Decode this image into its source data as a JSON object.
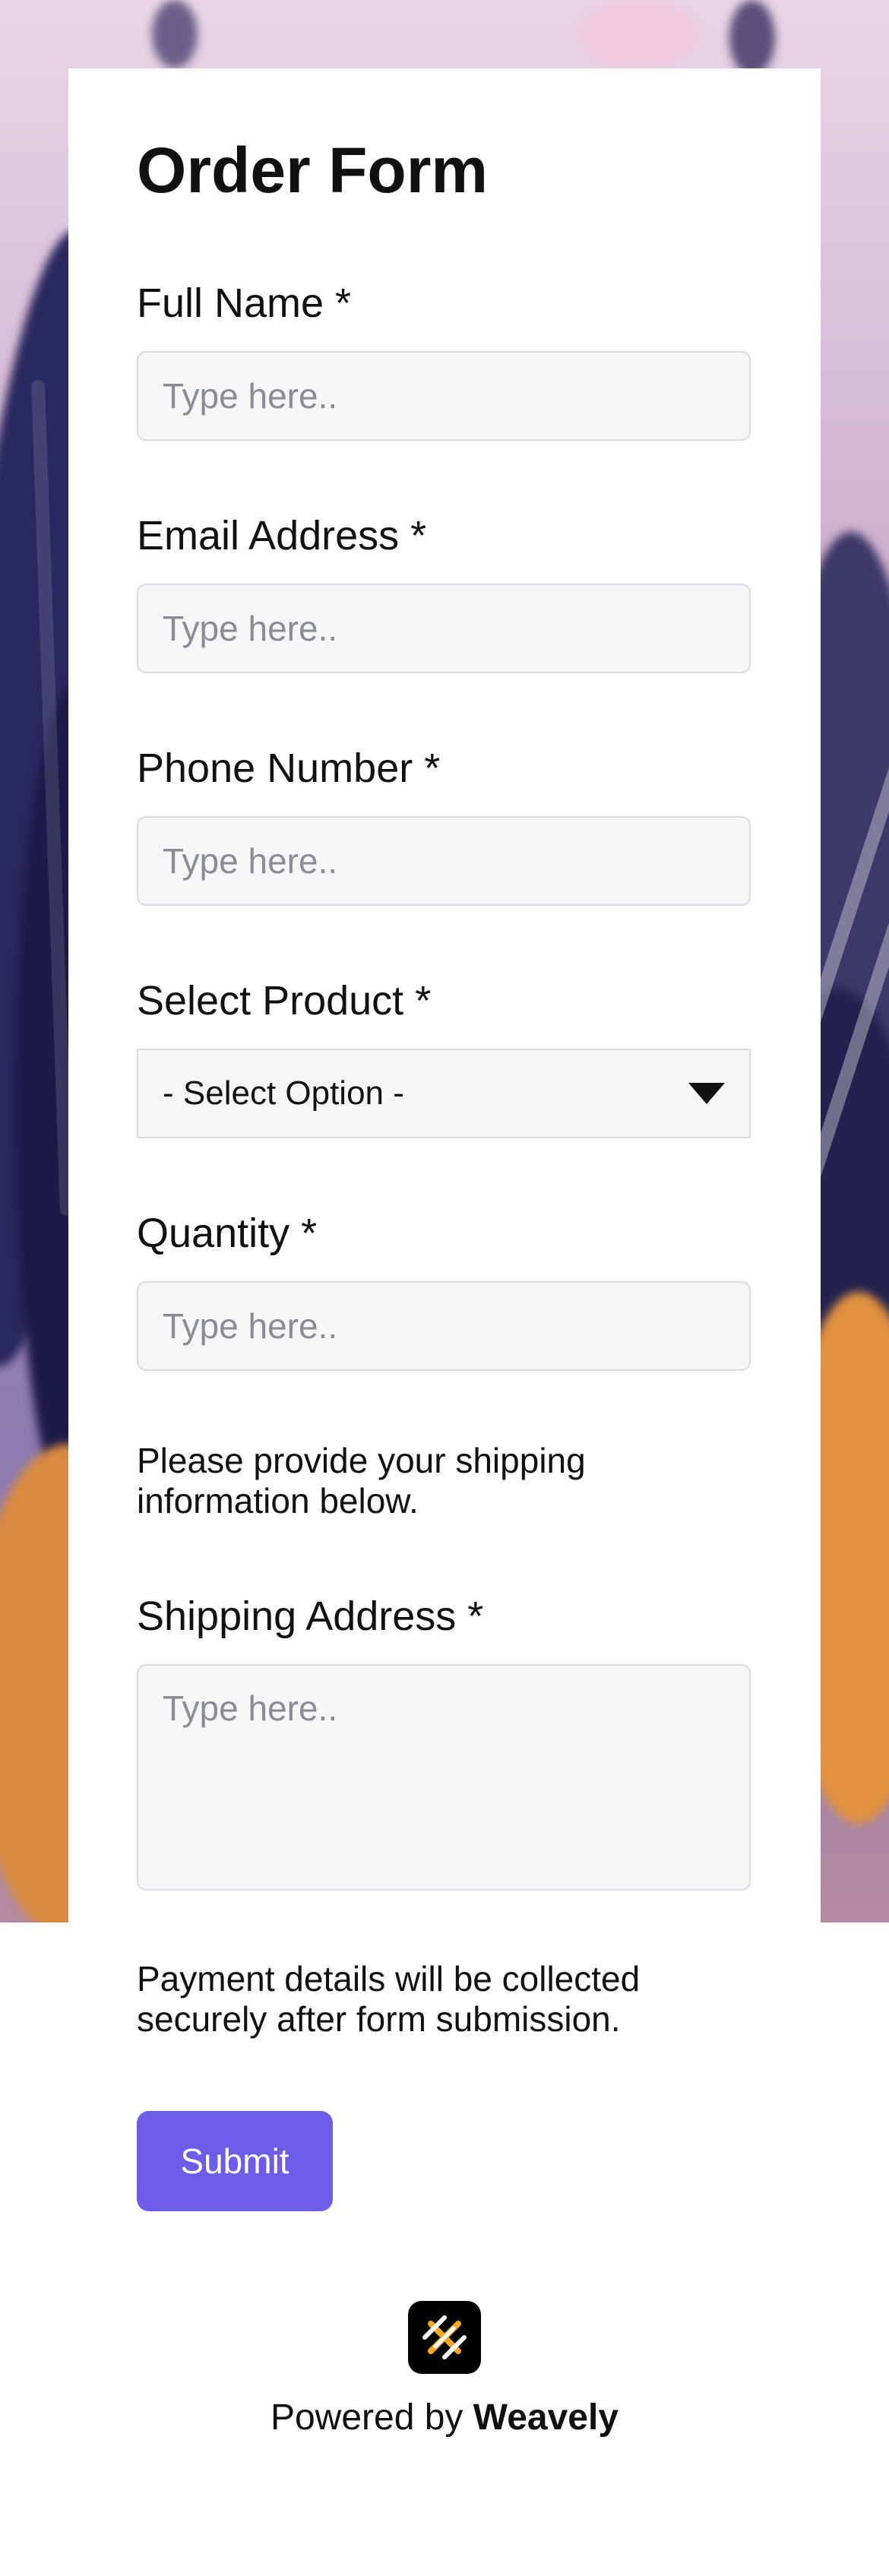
{
  "form": {
    "title": "Order Form",
    "fields": {
      "full_name": {
        "label": "Full Name *",
        "placeholder": "Type here.."
      },
      "email": {
        "label": "Email Address *",
        "placeholder": "Type here.."
      },
      "phone": {
        "label": "Phone Number *",
        "placeholder": "Type here.."
      },
      "product": {
        "label": "Select Product *",
        "selected": "- Select Option -"
      },
      "quantity": {
        "label": "Quantity *",
        "placeholder": "Type here.."
      },
      "shipping_address": {
        "label": "Shipping Address *",
        "placeholder": "Type here.."
      }
    },
    "shipping_note": "Please provide your shipping information below.",
    "payment_note": "Payment details will be collected securely after form submission.",
    "submit_label": "Submit"
  },
  "footer": {
    "powered_prefix": "Powered by",
    "brand": "Weavely",
    "logo_icon": "weavely-logo-icon"
  },
  "colors": {
    "accent": "#6c5ce7",
    "input_bg": "#f5f6f8",
    "input_border": "#d9dbe0",
    "logo_orange": "#f6a81c"
  }
}
